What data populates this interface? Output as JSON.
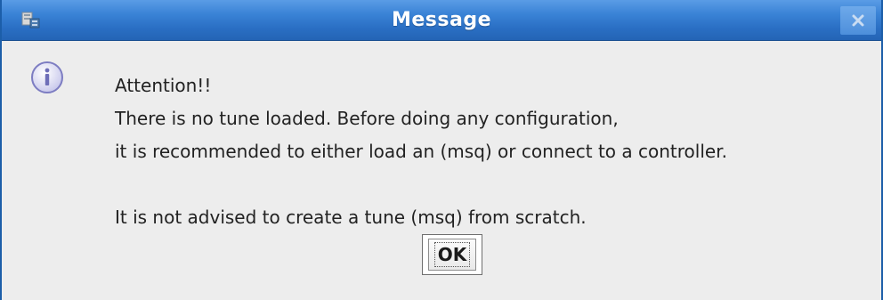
{
  "window": {
    "title": "Message",
    "accent_color": "#2a6fc4"
  },
  "titlebar": {
    "app_icon": "java-app-icon",
    "close_icon": "close-icon"
  },
  "dialog": {
    "icon": "info-icon",
    "lines": [
      "Attention!!",
      "There is no tune loaded. Before doing any configuration,",
      "it is recommended to either load an (msq) or connect to a controller.",
      "",
      "It is not advised to create a tune (msq) from scratch."
    ],
    "ok_label": "OK"
  }
}
